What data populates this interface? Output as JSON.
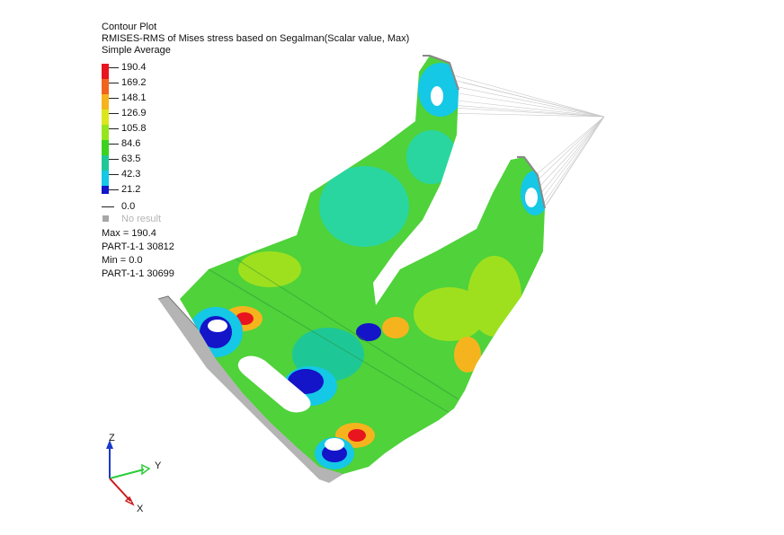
{
  "legend": {
    "title": "Contour Plot",
    "subtitle": "RMISES-RMS of Mises stress based on Segalman(Scalar value, Max)",
    "averaging": "Simple Average",
    "levels": [
      "190.4",
      "169.2",
      "148.1",
      "126.9",
      "105.8",
      "84.6",
      "63.5",
      "42.3",
      "21.2"
    ],
    "level_colors": [
      "#e8141e",
      "#f0641e",
      "#f5b41e",
      "#dce61e",
      "#96e61e",
      "#3cd21e",
      "#1ec896",
      "#14c8e6",
      "#1414c8"
    ],
    "zero_label": "0.0",
    "no_result_label": "No result",
    "max_label": "Max = 190.4",
    "max_location": "PART-1-1 30812",
    "min_label": "Min = 0.0",
    "min_location": "PART-1-1 30699"
  },
  "triad": {
    "z_label": "Z",
    "y_label": "Y",
    "x_label": "X"
  }
}
